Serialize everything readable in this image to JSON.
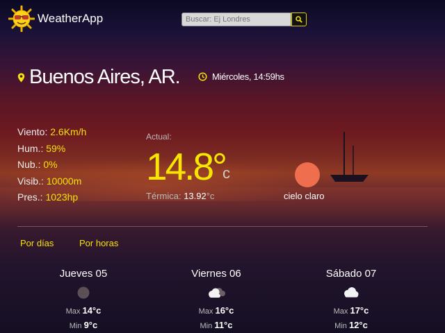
{
  "header": {
    "app_name": "WeatherApp",
    "search_placeholder": "Buscar: Ej Londres",
    "logo_icon": "sun-with-sunglasses-icon",
    "search_icon": "search-icon"
  },
  "location": {
    "city": "Buenos Aires, AR.",
    "datetime": "Miércoles, 14:59hs"
  },
  "stats": [
    {
      "label": "Viento:",
      "value": "2.6Km/h"
    },
    {
      "label": "Hum.:",
      "value": "59%"
    },
    {
      "label": "Nub.:",
      "value": "0%"
    },
    {
      "label": "Visib.:",
      "value": "10000m"
    },
    {
      "label": "Pres.:",
      "value": "1023hp"
    }
  ],
  "current": {
    "label": "Actual:",
    "temp": "14.8°",
    "unit": "c",
    "feels_label": "Térmica:",
    "feels_value": "13.92",
    "feels_unit": "°c",
    "description": "cielo claro"
  },
  "tabs": {
    "by_days": "Por días",
    "by_hours": "Por horas"
  },
  "forecast": [
    {
      "day": "Jueves 05",
      "max_label": "Max",
      "max": "14°c",
      "min_label": "Min",
      "min": "9°c",
      "icon": "moon-icon"
    },
    {
      "day": "Viernes 06",
      "max_label": "Max",
      "max": "16°c",
      "min_label": "Min",
      "min": "11°c",
      "icon": "cloudy-icon"
    },
    {
      "day": "Sábado 07",
      "max_label": "Max",
      "max": "17°c",
      "min_label": "Min",
      "min": "12°c",
      "icon": "cloud-icon"
    }
  ],
  "colors": {
    "accent": "#f4e20a",
    "sun": "#ee6e4e"
  }
}
